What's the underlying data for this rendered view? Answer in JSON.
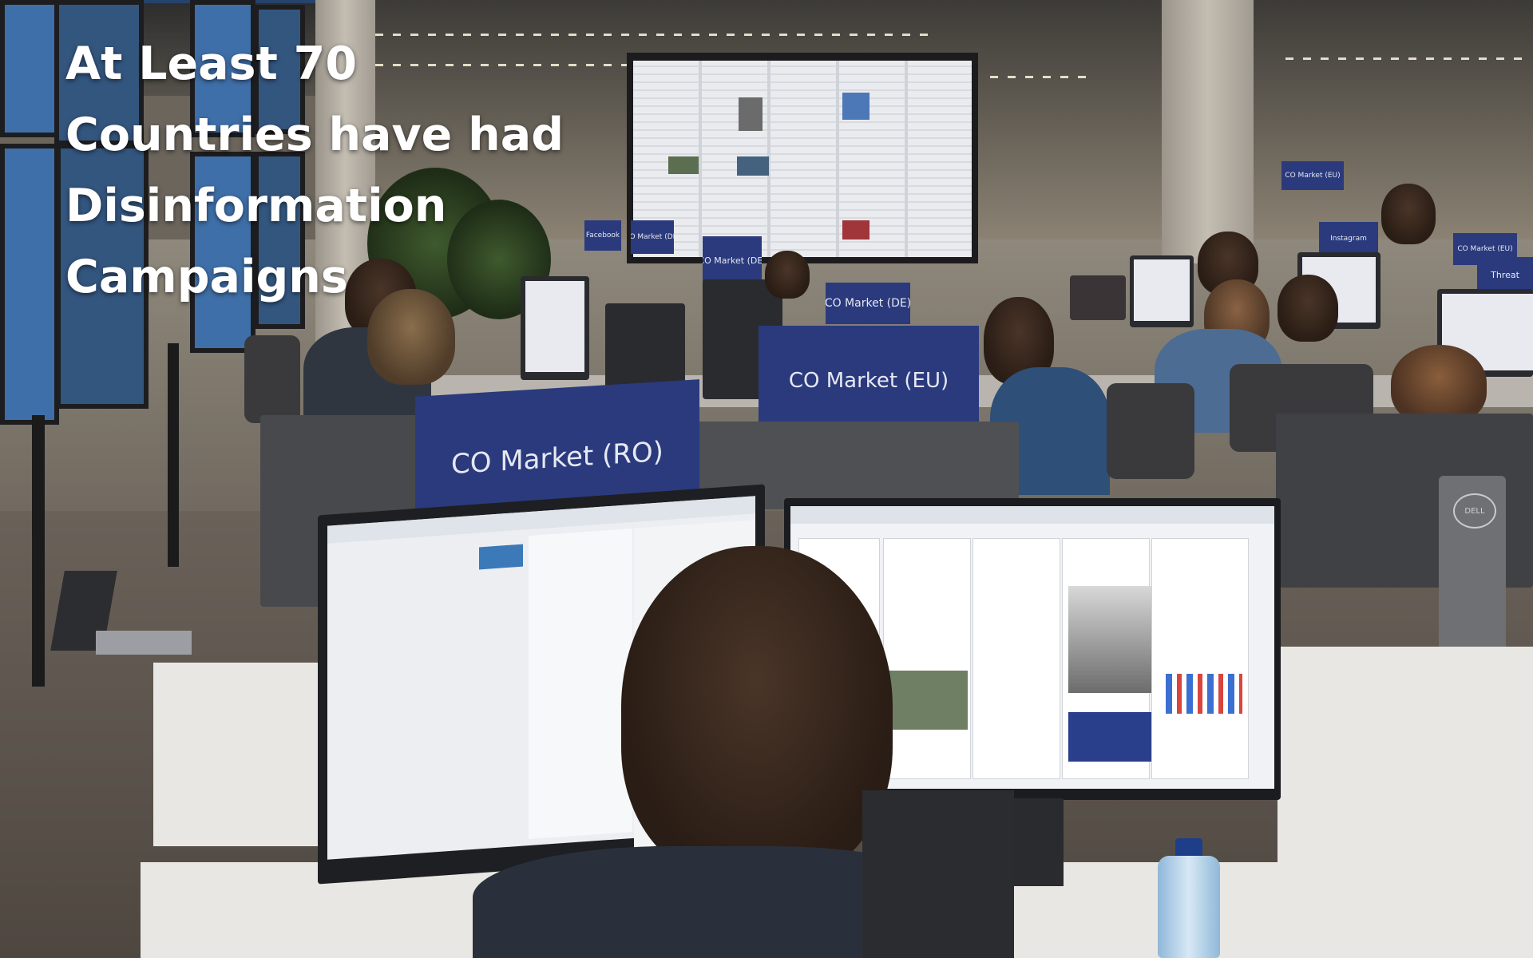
{
  "overlay": {
    "title_lines": [
      "At Least 70",
      "Countries have had",
      "Disinformation",
      "Campaigns"
    ]
  },
  "signs": {
    "front_left": "CO Market (RO)",
    "front_center": "CO Market (EU)",
    "mid_center": "CO Market (DE)",
    "mid_left_1": "Facebook",
    "mid_left_2": "CO Market (DE)",
    "back_right_1": "CO Market (EU)",
    "back_right_2": "Instagram",
    "back_right_3": "CO Market (EU)",
    "back_right_4": "Threat"
  },
  "brand": {
    "monitor_logo": "DELL"
  },
  "colors": {
    "sign_blue": "#2a3a7d",
    "title_text": "#ffffff",
    "wall_screen": "#3f6fa8"
  }
}
